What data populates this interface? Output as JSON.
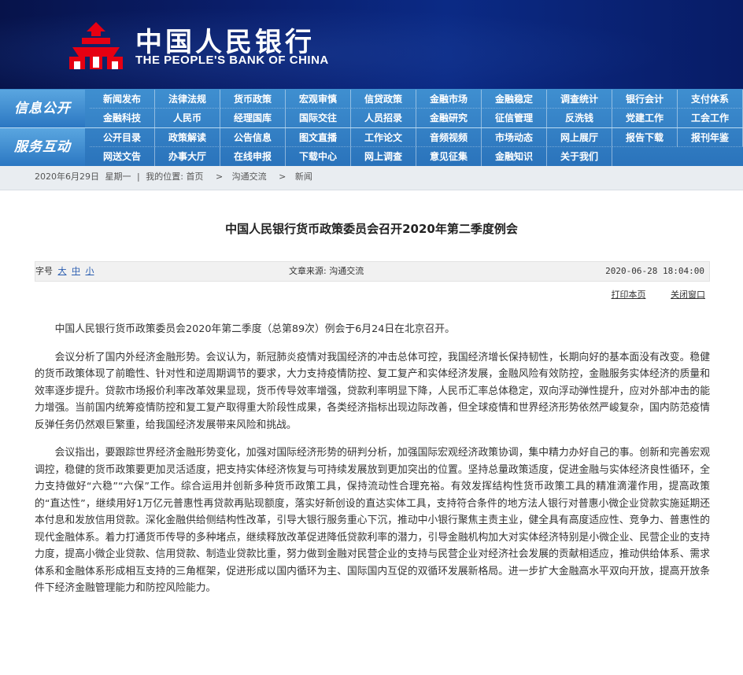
{
  "header": {
    "name_cn": "中国人民银行",
    "name_en": "THE PEOPLE'S BANK OF CHINA",
    "logo_icon": "pboc-emblem-icon",
    "logo_color": "#e60012"
  },
  "nav": {
    "section1_title": "信息公开",
    "section1_row1": [
      "新闻发布",
      "法律法规",
      "货币政策",
      "宏观审慎",
      "信贷政策",
      "金融市场",
      "金融稳定",
      "调查统计",
      "银行会计",
      "支付体系"
    ],
    "section1_row2": [
      "金融科技",
      "人民币",
      "经理国库",
      "国际交往",
      "人员招录",
      "金融研究",
      "征信管理",
      "反洗钱",
      "党建工作",
      "工会工作"
    ],
    "section2_title": "服务互动",
    "section2_row1": [
      "公开目录",
      "政策解读",
      "公告信息",
      "图文直播",
      "工作论文",
      "音频视频",
      "市场动态",
      "网上展厅",
      "报告下载",
      "报刊年鉴"
    ],
    "section2_row2": [
      "网送文告",
      "办事大厅",
      "在线申报",
      "下载中心",
      "网上调查",
      "意见征集",
      "金融知识",
      "关于我们"
    ]
  },
  "breadcrumb": {
    "date": "2020年6月29日",
    "weekday": "星期一",
    "sep": "|",
    "location_label": "我的位置:",
    "items": [
      "首页",
      "沟通交流",
      "新闻"
    ],
    "arrow": ">"
  },
  "article": {
    "title": "中国人民银行货币政策委员会召开2020年第二季度例会",
    "font_size_label": "字号",
    "font_sizes": [
      "大",
      "中",
      "小"
    ],
    "source_label": "文章来源:",
    "source": "沟通交流",
    "datetime": "2020-06-28 18:04:00",
    "print_label": "打印本页",
    "close_label": "关闭窗口",
    "paragraphs": [
      "中国人民银行货币政策委员会2020年第二季度（总第89次）例会于6月24日在北京召开。",
      "会议分析了国内外经济金融形势。会议认为，新冠肺炎疫情对我国经济的冲击总体可控，我国经济增长保持韧性，长期向好的基本面没有改变。稳健的货币政策体现了前瞻性、针对性和逆周期调节的要求，大力支持疫情防控、复工复产和实体经济发展，金融风险有效防控，金融服务实体经济的质量和效率逐步提升。贷款市场报价利率改革效果显现，货币传导效率增强，贷款利率明显下降，人民币汇率总体稳定，双向浮动弹性提升，应对外部冲击的能力增强。当前国内统筹疫情防控和复工复产取得重大阶段性成果，各类经济指标出现边际改善，但全球疫情和世界经济形势依然严峻复杂，国内防范疫情反弹任务仍然艰巨繁重，给我国经济发展带来风险和挑战。",
      "会议指出，要跟踪世界经济金融形势变化，加强对国际经济形势的研判分析，加强国际宏观经济政策协调，集中精力办好自己的事。创新和完善宏观调控，稳健的货币政策要更加灵活适度，把支持实体经济恢复与可持续发展放到更加突出的位置。坚持总量政策适度，促进金融与实体经济良性循环，全力支持做好“六稳”“六保”工作。综合运用并创新多种货币政策工具，保持流动性合理充裕。有效发挥结构性货币政策工具的精准滴灌作用，提高政策的“直达性”，继续用好1万亿元普惠性再贷款再贴现额度，落实好新创设的直达实体工具，支持符合条件的地方法人银行对普惠小微企业贷款实施延期还本付息和发放信用贷款。深化金融供给侧结构性改革，引导大银行服务重心下沉，推动中小银行聚焦主责主业，健全具有高度适应性、竞争力、普惠性的现代金融体系。着力打通货币传导的多种堵点，继续释放改革促进降低贷款利率的潜力，引导金融机构加大对实体经济特别是小微企业、民营企业的支持力度，提高小微企业贷款、信用贷款、制造业贷款比重，努力做到金融对民营企业的支持与民营企业对经济社会发展的贡献相适应，推动供给体系、需求体系和金融体系形成相互支持的三角框架，促进形成以国内循环为主、国际国内互促的双循环发展新格局。进一步扩大金融高水平双向开放，提高开放条件下经济金融管理能力和防控风险能力。"
    ]
  }
}
